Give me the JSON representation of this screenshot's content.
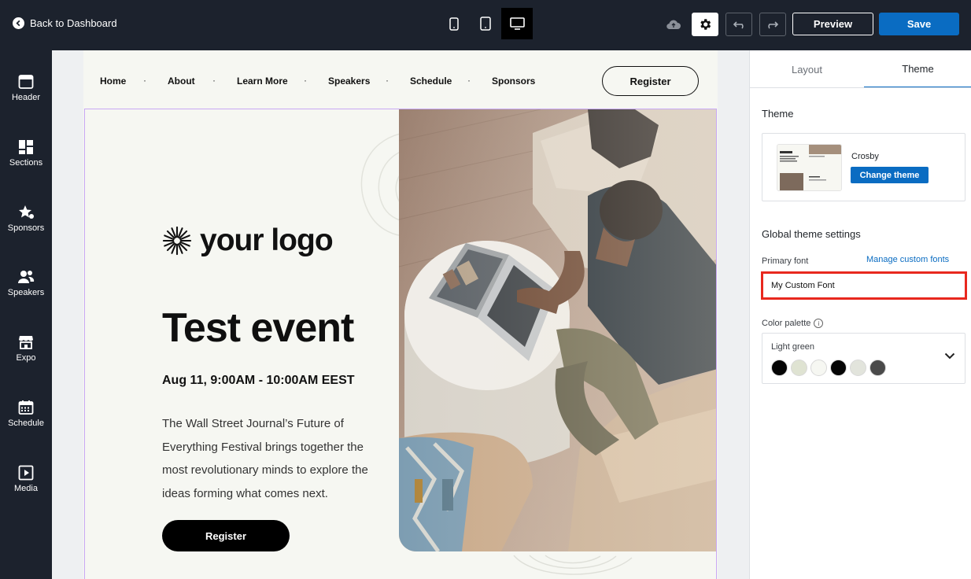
{
  "topbar": {
    "back_label": "Back to Dashboard",
    "preview_label": "Preview",
    "save_label": "Save",
    "devices": [
      "mobile-icon",
      "tablet-icon",
      "desktop-icon"
    ],
    "active_device": "desktop"
  },
  "sidebar": {
    "items": [
      {
        "label": "Header",
        "icon": "header-icon"
      },
      {
        "label": "Sections",
        "icon": "sections-icon"
      },
      {
        "label": "Sponsors",
        "icon": "sponsors-icon"
      },
      {
        "label": "Speakers",
        "icon": "speakers-icon"
      },
      {
        "label": "Expo",
        "icon": "expo-icon"
      },
      {
        "label": "Schedule",
        "icon": "schedule-icon"
      },
      {
        "label": "Media",
        "icon": "media-icon"
      }
    ]
  },
  "site": {
    "nav": [
      "Home",
      "About",
      "Learn More",
      "Speakers",
      "Schedule",
      "Sponsors"
    ],
    "nav_register": "Register",
    "logo_text": "your logo",
    "title": "Test event",
    "date": "Aug 11, 9:00AM - 10:00AM EEST",
    "description": "The Wall Street Journal’s Future of Everything Festival brings together the most revolutionary minds to explore the ideas forming what comes next.",
    "register": "Register"
  },
  "panel": {
    "tabs": [
      "Layout",
      "Theme"
    ],
    "active_tab": "Theme",
    "theme_heading": "Theme",
    "theme_name": "Crosby",
    "change_theme": "Change theme",
    "global_heading": "Global theme settings",
    "primary_font_label": "Primary font",
    "manage_fonts": "Manage custom fonts",
    "primary_font_value": "My Custom Font",
    "color_palette_label": "Color palette",
    "palette_name": "Light green",
    "palette_colors": [
      "#050505",
      "#dfe3d2",
      "#f6f7f2",
      "#050505",
      "#e2e4dc",
      "#4a4a4a"
    ]
  },
  "colors": {
    "brand_blue": "#0a6cc2",
    "dark_chrome": "#1c222d",
    "highlight_red": "#e8281e"
  }
}
